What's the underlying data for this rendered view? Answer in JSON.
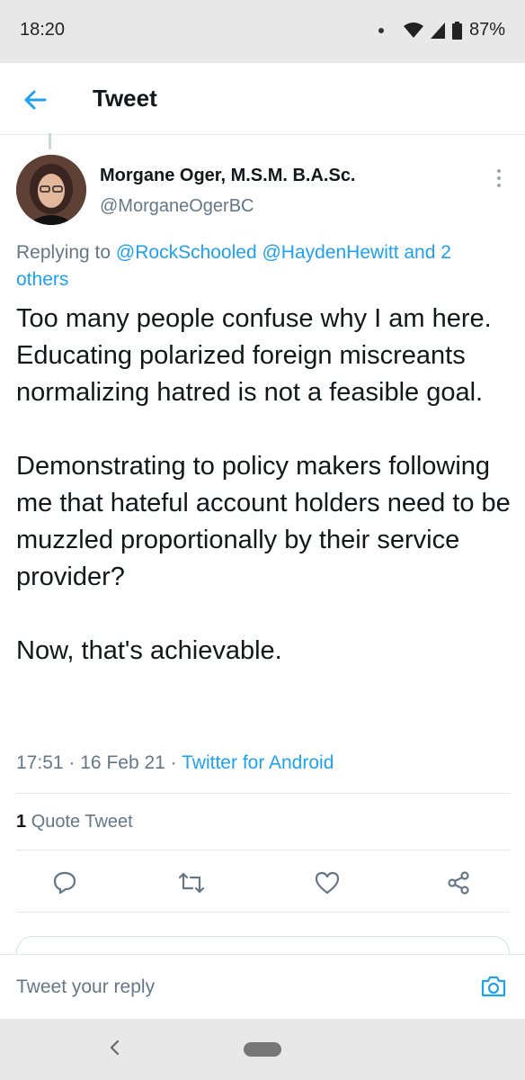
{
  "status_bar": {
    "time": "18:20",
    "battery": "87%",
    "icons": [
      "notification-dot-icon",
      "wifi-icon",
      "signal-icon",
      "battery-icon"
    ]
  },
  "app_bar": {
    "title": "Tweet",
    "back_icon": "back-arrow-icon"
  },
  "tweet": {
    "author_name": "Morgane Oger, M.S.M. B.A.Sc.",
    "author_handle": "@MorganeOgerBC",
    "replying_to_prefix": "Replying to",
    "replying_to_user1": "@RockSchooled",
    "replying_to_user2": "@HaydenHewitt",
    "replying_to_suffix": "and 2 others",
    "paragraphs": [
      "Too many people confuse why I am here. Educating polarized foreign miscreants normalizing hatred is not a feasible goal.",
      "Demonstrating to policy makers following me that hateful account holders need to be muzzled proportionally by their service provider?",
      "Now, that's achievable."
    ],
    "time": "17:51",
    "date": "16 Feb 21",
    "client": "Twitter for Android",
    "separator": "·"
  },
  "stats": {
    "quote_count": "1",
    "quote_label": "Quote Tweet"
  },
  "actions": [
    "reply-icon",
    "retweet-icon",
    "like-icon",
    "share-icon"
  ],
  "reply_bar": {
    "placeholder": "Tweet your reply",
    "camera_icon": "camera-icon"
  },
  "colors": {
    "accent": "#1da1f2",
    "secondary_text": "#657786",
    "primary_text": "#14171a",
    "system_bar": "#e8e8e8"
  }
}
